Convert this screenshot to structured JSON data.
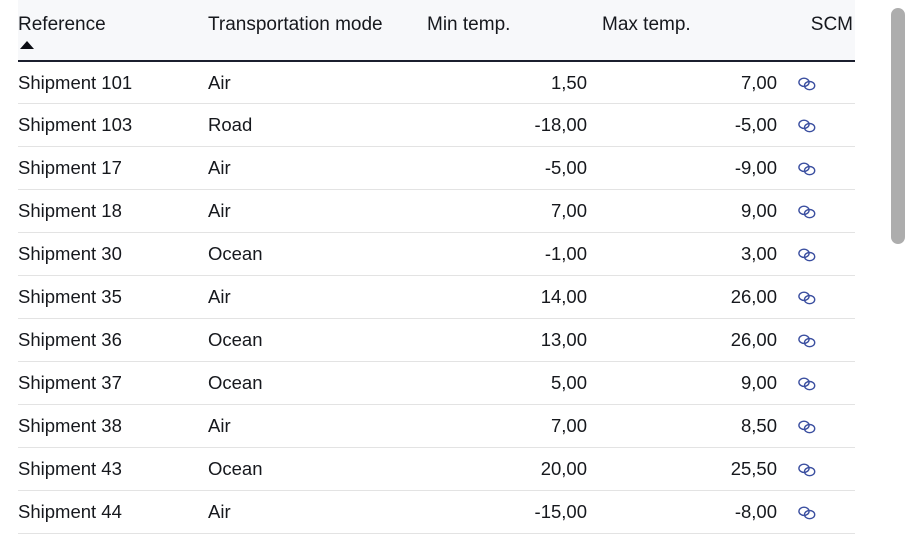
{
  "table": {
    "columns": [
      {
        "key": "reference",
        "label": "Reference",
        "align": "left",
        "sorted": true,
        "sort_direction": "ascending",
        "sort_icon": "sort-ascending-triangle-icon"
      },
      {
        "key": "transportation_mode",
        "label": "Transportation mode",
        "align": "left",
        "sorted": false
      },
      {
        "key": "min_temp",
        "label": "Min temp.",
        "align": "right",
        "sorted": false
      },
      {
        "key": "max_temp",
        "label": "Max temp.",
        "align": "right",
        "sorted": false
      },
      {
        "key": "scm",
        "label": "SCM",
        "align": "right",
        "sorted": false
      }
    ],
    "rows": [
      {
        "reference": "Shipment 101",
        "transportation_mode": "Air",
        "min_temp": "1,50",
        "max_temp": "7,00",
        "scm_icon": "link-chain-icon"
      },
      {
        "reference": "Shipment 103",
        "transportation_mode": "Road",
        "min_temp": "-18,00",
        "max_temp": "-5,00",
        "scm_icon": "link-chain-icon"
      },
      {
        "reference": "Shipment 17",
        "transportation_mode": "Air",
        "min_temp": "-5,00",
        "max_temp": "-9,00",
        "scm_icon": "link-chain-icon"
      },
      {
        "reference": "Shipment 18",
        "transportation_mode": "Air",
        "min_temp": "7,00",
        "max_temp": "9,00",
        "scm_icon": "link-chain-icon"
      },
      {
        "reference": "Shipment 30",
        "transportation_mode": "Ocean",
        "min_temp": "-1,00",
        "max_temp": "3,00",
        "scm_icon": "link-chain-icon"
      },
      {
        "reference": "Shipment 35",
        "transportation_mode": "Air",
        "min_temp": "14,00",
        "max_temp": "26,00",
        "scm_icon": "link-chain-icon"
      },
      {
        "reference": "Shipment 36",
        "transportation_mode": "Ocean",
        "min_temp": "13,00",
        "max_temp": "26,00",
        "scm_icon": "link-chain-icon"
      },
      {
        "reference": "Shipment 37",
        "transportation_mode": "Ocean",
        "min_temp": "5,00",
        "max_temp": "9,00",
        "scm_icon": "link-chain-icon"
      },
      {
        "reference": "Shipment 38",
        "transportation_mode": "Air",
        "min_temp": "7,00",
        "max_temp": "8,50",
        "scm_icon": "link-chain-icon"
      },
      {
        "reference": "Shipment 43",
        "transportation_mode": "Ocean",
        "min_temp": "20,00",
        "max_temp": "25,50",
        "scm_icon": "link-chain-icon"
      },
      {
        "reference": "Shipment 44",
        "transportation_mode": "Air",
        "min_temp": "-15,00",
        "max_temp": "-8,00",
        "scm_icon": "link-chain-icon"
      }
    ]
  },
  "scrollbar": {
    "orientation": "vertical",
    "thumb_icon": "scrollbar-thumb-icon"
  },
  "colors": {
    "header_background": "#f7f8fa",
    "header_rule": "#1b1f2e",
    "row_separator": "#e3e3e3",
    "text": "#16181d",
    "link_icon": "#3b4fa0",
    "scrollbar_thumb": "#adadad"
  }
}
